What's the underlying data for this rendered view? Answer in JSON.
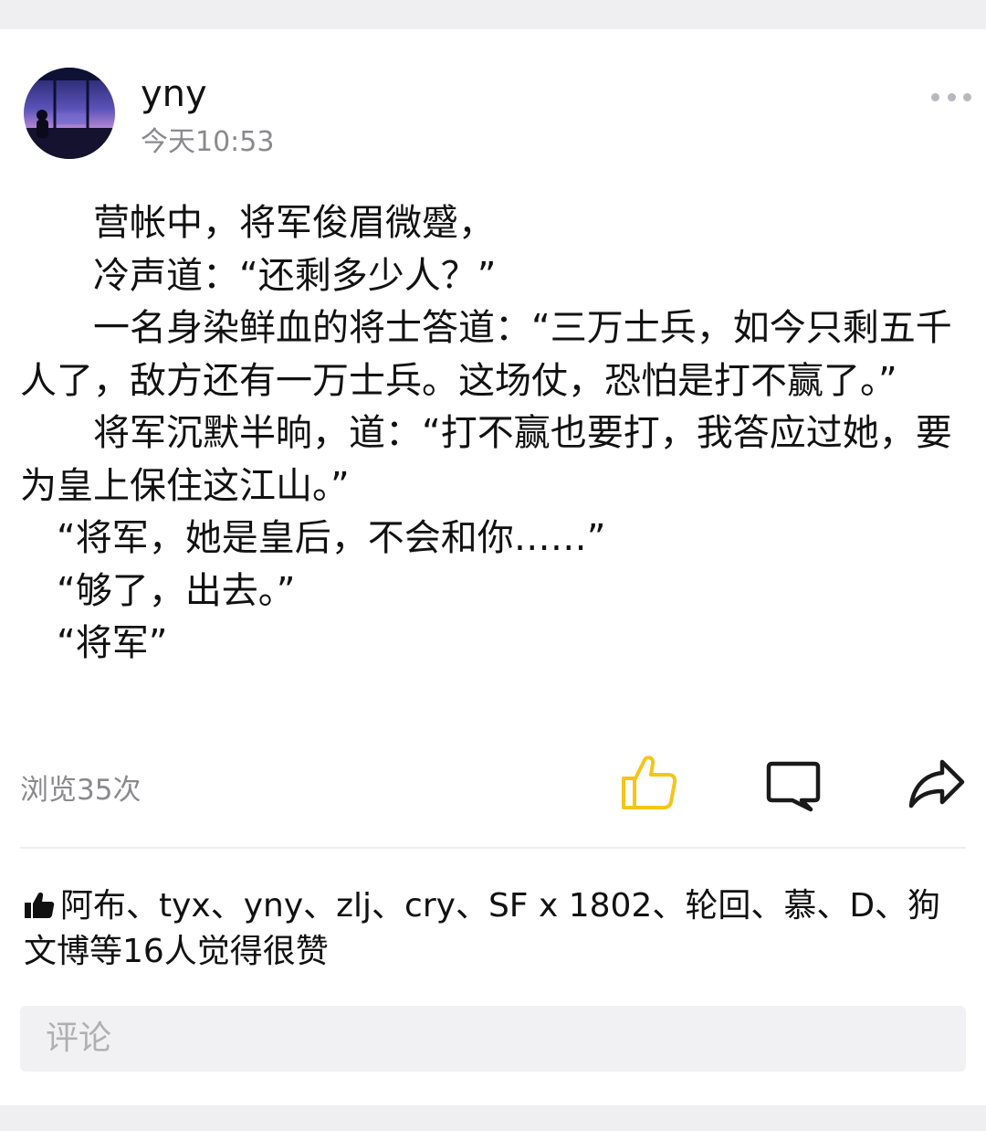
{
  "post": {
    "author": "yny",
    "time": "今天10:53",
    "body": "　　营帐中，将军俊眉微蹙，\n　　冷声道：“还剩多少人？”\n　　一名身染鲜血的将士答道：“三万士兵，如今只剩五千人了，敌方还有一万士兵。这场仗，恐怕是打不赢了。”\n　　将军沉默半晌，道：“打不赢也要打，我答应过她，要为皇上保住这江山。”\n　“将军，她是皇后，不会和你……”\n　“够了，出去。”\n　“将军”",
    "views": "浏览35次"
  },
  "actions": {
    "like_icon": "thumbs-up-icon",
    "comment_icon": "comment-icon",
    "share_icon": "share-arrow-icon",
    "more_icon": "more-dots-icon",
    "accent_color": "#f5c518"
  },
  "likes": {
    "text": "阿布、tyx、yny、zlj、cry、SF x 1802、轮回、慕、D、狗文博等16人觉得很赞"
  },
  "comment": {
    "placeholder": "评论"
  }
}
